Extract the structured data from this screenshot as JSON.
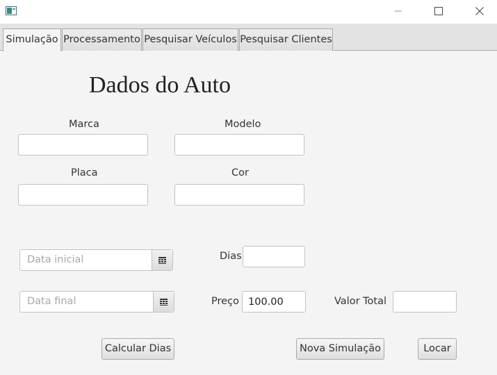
{
  "tabs": [
    "Simulação",
    "Processamento",
    "Pesquisar Veículos",
    "Pesquisar Clientes"
  ],
  "heading": "Dados do Auto",
  "fields": {
    "marca": {
      "label": "Marca",
      "value": ""
    },
    "modelo": {
      "label": "Modelo",
      "value": ""
    },
    "placa": {
      "label": "Placa",
      "value": ""
    },
    "cor": {
      "label": "Cor",
      "value": ""
    }
  },
  "dates": {
    "inicial_placeholder": "Data inicial",
    "final_placeholder": "Data final"
  },
  "dias": {
    "label": "Dias",
    "value": ""
  },
  "preco": {
    "label": "Preço",
    "value": "100.00"
  },
  "valor_total": {
    "label": "Valor Total",
    "value": ""
  },
  "buttons": {
    "calcular": "Calcular Dias",
    "nova": "Nova Simulação",
    "locar": "Locar"
  },
  "icons": {
    "app": "java-window-icon",
    "minimize": "minimize-icon",
    "maximize": "maximize-icon",
    "close": "close-icon",
    "calendar": "calendar-icon"
  }
}
